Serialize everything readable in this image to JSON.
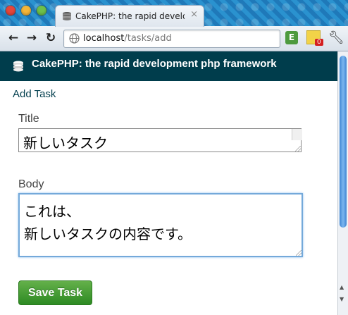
{
  "browser": {
    "tab_title": "CakePHP: the rapid development php framework",
    "tab_close": "×",
    "url_host": "localhost",
    "url_path": "/tasks/add",
    "extension_badge": "0",
    "icons": [
      "close-window-icon",
      "minimize-window-icon",
      "maximize-window-icon",
      "cake-icon",
      "back-arrow-icon",
      "forward-arrow-icon",
      "reload-icon",
      "globe-icon",
      "evernote-icon",
      "sticky-note-icon",
      "wrench-icon"
    ]
  },
  "page": {
    "site_title": "CakePHP: the rapid development php framework",
    "heading": "Add Task",
    "form": {
      "title_label": "Title",
      "title_value": "新しいタスク",
      "body_label": "Body",
      "body_value": "これは、\n新しいタスクの内容です。",
      "submit_label": "Save Task"
    }
  },
  "colors": {
    "header_bg": "#003d4c",
    "button_green": "#2d8a23",
    "focus_blue": "#74a9da"
  }
}
